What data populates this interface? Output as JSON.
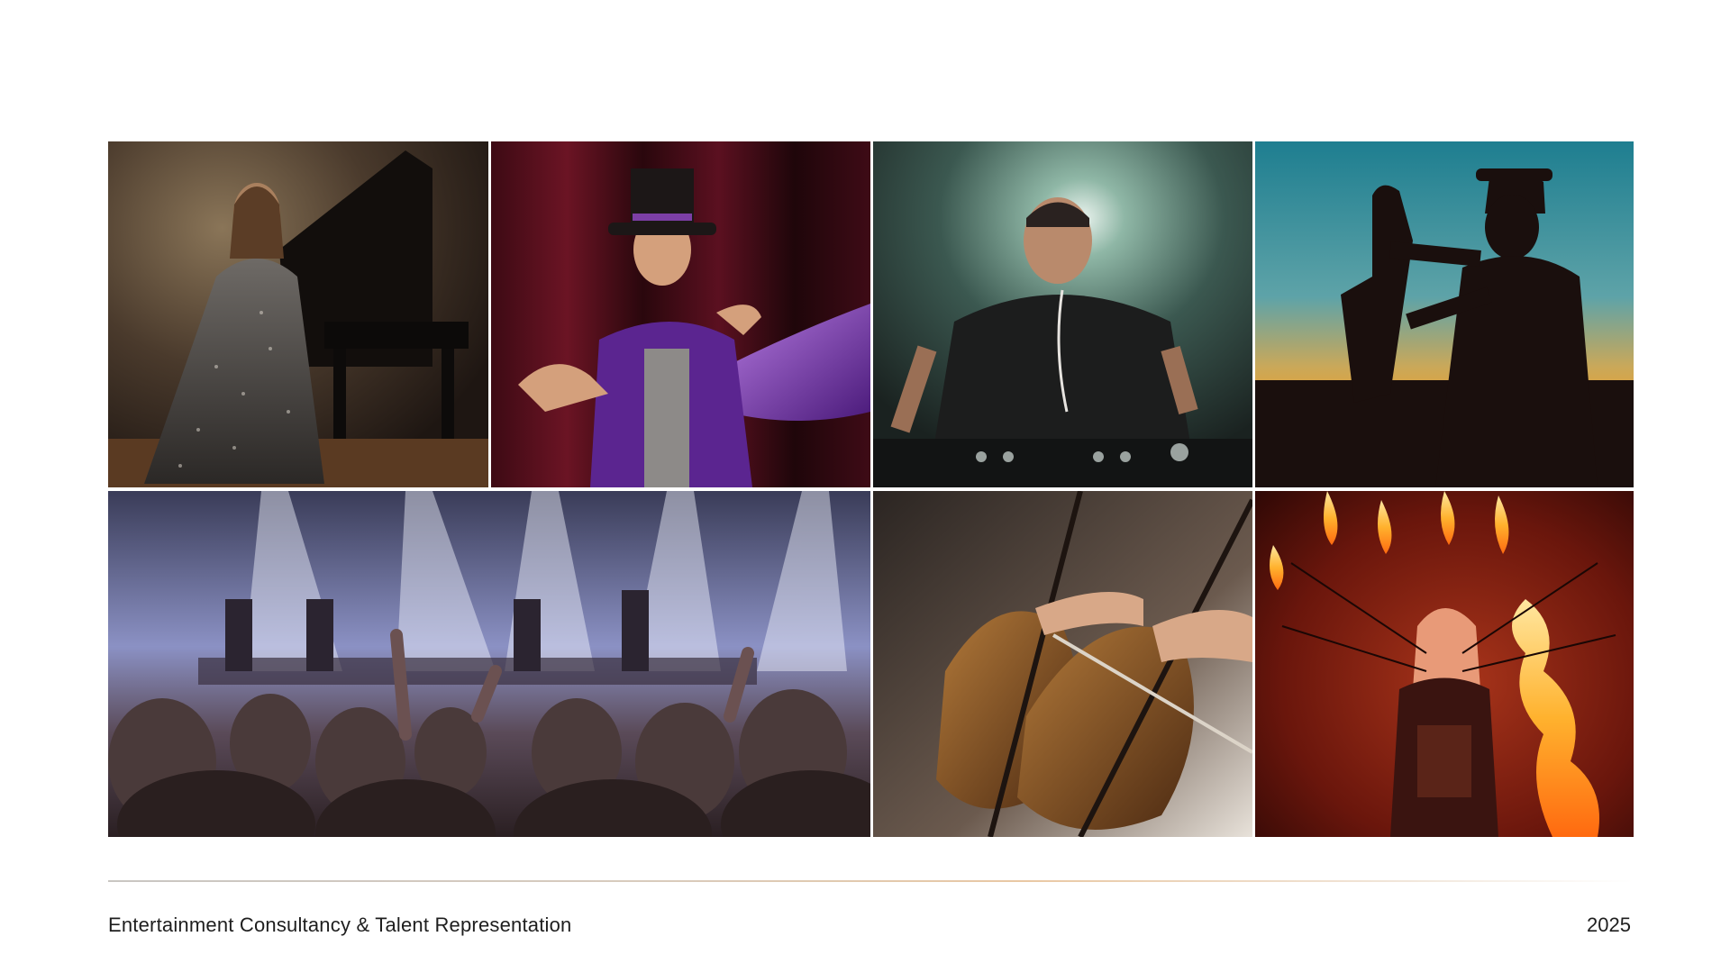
{
  "gallery": {
    "photos": [
      {
        "name": "pianist-photo"
      },
      {
        "name": "magician-photo"
      },
      {
        "name": "dj-photo"
      },
      {
        "name": "saxophonist-silhouette-photo"
      },
      {
        "name": "concert-crowd-photo"
      },
      {
        "name": "cello-orchestra-photo"
      },
      {
        "name": "fire-performer-photo"
      }
    ]
  },
  "footer": {
    "tagline": "Entertainment Consultancy & Talent Representation",
    "year": "2025"
  }
}
